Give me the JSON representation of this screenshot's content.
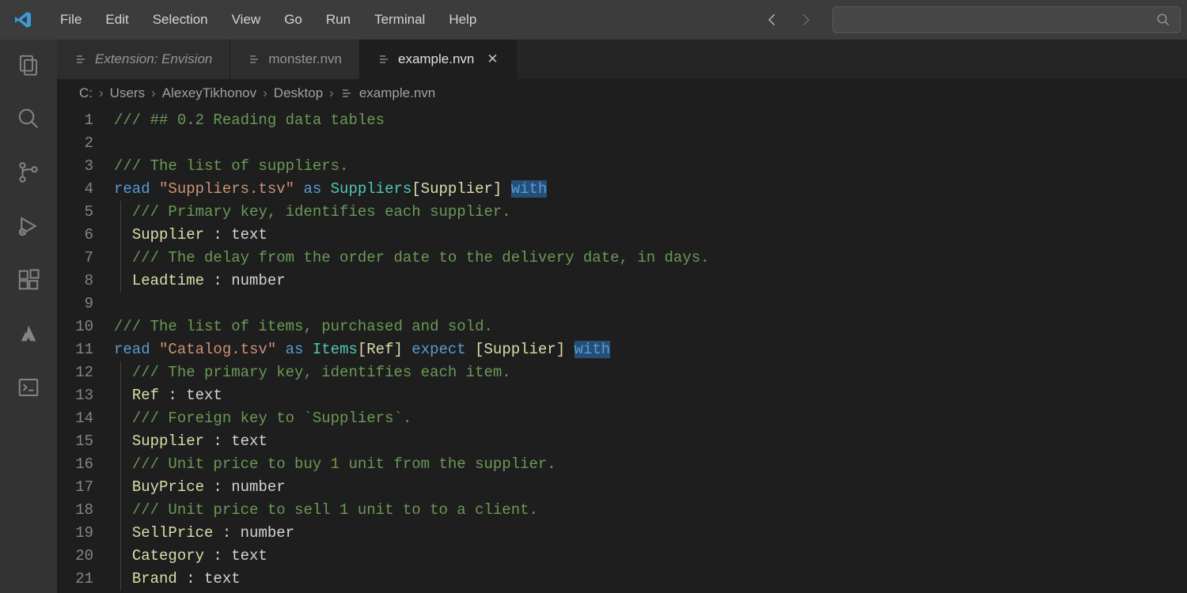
{
  "menu": {
    "items": [
      "File",
      "Edit",
      "Selection",
      "View",
      "Go",
      "Run",
      "Terminal",
      "Help"
    ]
  },
  "nav": {
    "back_enabled": true,
    "forward_enabled": false
  },
  "search": {
    "placeholder": "Search"
  },
  "activity": {
    "items": [
      {
        "name": "explorer-icon",
        "active": false
      },
      {
        "name": "search-icon",
        "active": false
      },
      {
        "name": "source-control-icon",
        "active": false
      },
      {
        "name": "run-debug-icon",
        "active": false
      },
      {
        "name": "extensions-icon",
        "active": false
      },
      {
        "name": "atlassian-icon",
        "active": false
      },
      {
        "name": "terminal-panel-icon",
        "active": false
      }
    ]
  },
  "tabs": [
    {
      "label": "Extension: Envision",
      "italic": true,
      "active": false,
      "closeable": false
    },
    {
      "label": "monster.nvn",
      "italic": false,
      "active": false,
      "closeable": false
    },
    {
      "label": "example.nvn",
      "italic": false,
      "active": true,
      "closeable": true
    }
  ],
  "breadcrumb": {
    "parts": [
      "C:",
      "Users",
      "AlexeyTikhonov",
      "Desktop",
      "example.nvn"
    ]
  },
  "code": {
    "start_line": 1,
    "lines": [
      {
        "indent": 0,
        "tokens": [
          [
            "comment",
            "/// ## 0.2 Reading data tables"
          ]
        ]
      },
      {
        "indent": 0,
        "tokens": [
          [
            "plain",
            ""
          ]
        ]
      },
      {
        "indent": 0,
        "tokens": [
          [
            "comment",
            "/// The list of suppliers."
          ]
        ]
      },
      {
        "indent": 0,
        "tokens": [
          [
            "kw",
            "read "
          ],
          [
            "str",
            "\"Suppliers.tsv\""
          ],
          [
            "kw",
            " as "
          ],
          [
            "type",
            "Suppliers"
          ],
          [
            "typebracket",
            "[Supplier]"
          ],
          [
            "plain",
            " "
          ],
          [
            "kw-sel",
            "with"
          ]
        ]
      },
      {
        "indent": 1,
        "tokens": [
          [
            "comment",
            "/// Primary key, identifies each supplier."
          ]
        ]
      },
      {
        "indent": 1,
        "tokens": [
          [
            "id",
            "Supplier"
          ],
          [
            "plain",
            " : text"
          ]
        ]
      },
      {
        "indent": 1,
        "tokens": [
          [
            "comment",
            "/// The delay from the order date to the delivery date, in days."
          ]
        ]
      },
      {
        "indent": 1,
        "tokens": [
          [
            "id",
            "Leadtime"
          ],
          [
            "plain",
            " : number"
          ]
        ]
      },
      {
        "indent": 0,
        "tokens": [
          [
            "plain",
            ""
          ]
        ]
      },
      {
        "indent": 0,
        "tokens": [
          [
            "comment",
            "/// The list of items, purchased and sold."
          ]
        ]
      },
      {
        "indent": 0,
        "tokens": [
          [
            "kw",
            "read "
          ],
          [
            "str",
            "\"Catalog.tsv\""
          ],
          [
            "kw",
            " as "
          ],
          [
            "type",
            "Items"
          ],
          [
            "typebracket",
            "[Ref]"
          ],
          [
            "kw",
            " expect "
          ],
          [
            "typebracket",
            "[Supplier]"
          ],
          [
            "plain",
            " "
          ],
          [
            "kw-sel",
            "with"
          ]
        ]
      },
      {
        "indent": 1,
        "tokens": [
          [
            "comment",
            "/// The primary key, identifies each item."
          ]
        ]
      },
      {
        "indent": 1,
        "tokens": [
          [
            "id",
            "Ref"
          ],
          [
            "plain",
            " : text"
          ]
        ]
      },
      {
        "indent": 1,
        "tokens": [
          [
            "comment",
            "/// Foreign key to `Suppliers`."
          ]
        ]
      },
      {
        "indent": 1,
        "tokens": [
          [
            "id",
            "Supplier"
          ],
          [
            "plain",
            " : text"
          ]
        ]
      },
      {
        "indent": 1,
        "tokens": [
          [
            "comment",
            "/// Unit price to buy 1 unit from the supplier."
          ]
        ]
      },
      {
        "indent": 1,
        "tokens": [
          [
            "id",
            "BuyPrice"
          ],
          [
            "plain",
            " : number"
          ]
        ]
      },
      {
        "indent": 1,
        "tokens": [
          [
            "comment",
            "/// Unit price to sell 1 unit to to a client."
          ]
        ]
      },
      {
        "indent": 1,
        "tokens": [
          [
            "id",
            "SellPrice"
          ],
          [
            "plain",
            " : number"
          ]
        ]
      },
      {
        "indent": 1,
        "tokens": [
          [
            "id",
            "Category"
          ],
          [
            "plain",
            " : text"
          ]
        ]
      },
      {
        "indent": 1,
        "tokens": [
          [
            "id",
            "Brand"
          ],
          [
            "plain",
            " : text"
          ]
        ]
      }
    ]
  }
}
